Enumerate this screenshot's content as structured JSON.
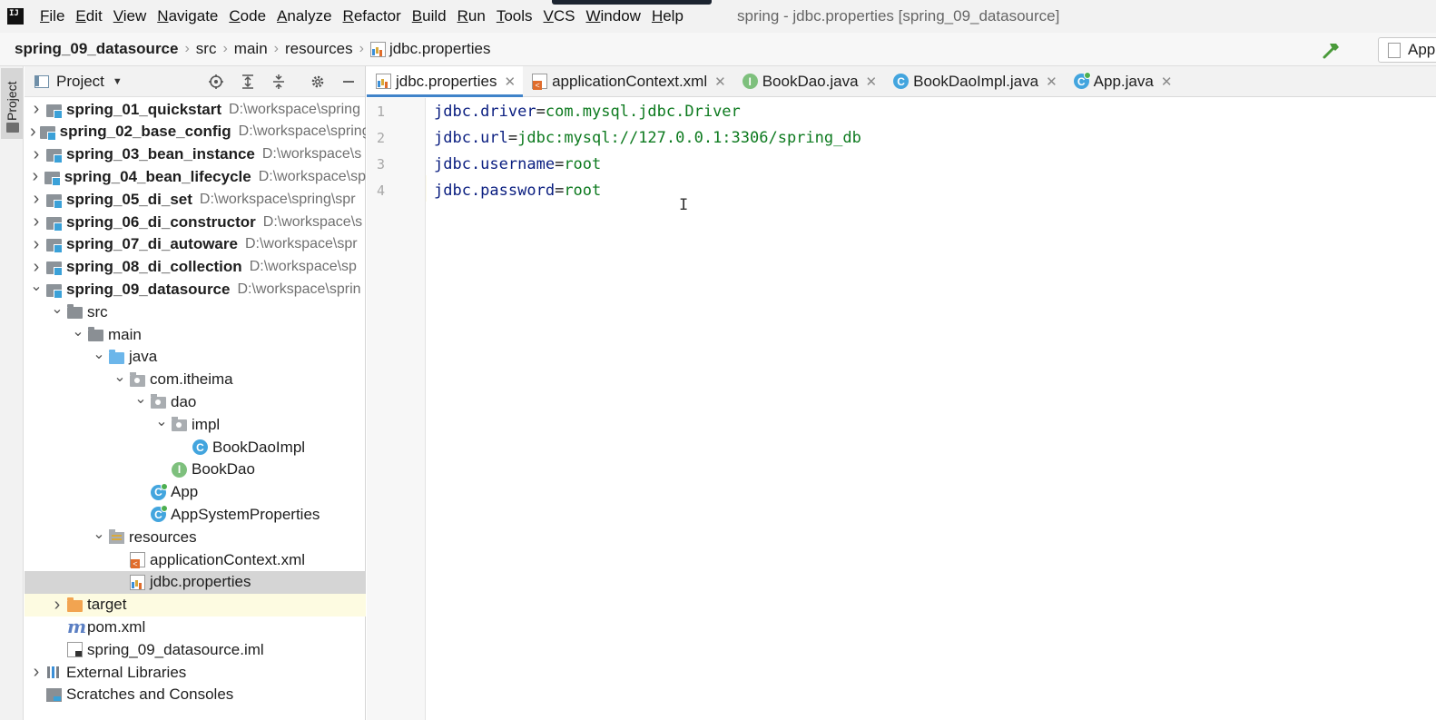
{
  "menu": {
    "logo": "IJ",
    "items": [
      "File",
      "Edit",
      "View",
      "Navigate",
      "Code",
      "Analyze",
      "Refactor",
      "Build",
      "Run",
      "Tools",
      "VCS",
      "Window",
      "Help"
    ],
    "window_title": "spring - jdbc.properties [spring_09_datasource]"
  },
  "breadcrumb": [
    "spring_09_datasource",
    "src",
    "main",
    "resources",
    "jdbc.properties"
  ],
  "run_config": {
    "label": "App"
  },
  "tool_stripe": {
    "project_label": "Project"
  },
  "project_panel": {
    "title": "Project",
    "tree": [
      {
        "depth": 0,
        "expand": "collapsed",
        "icon": "module",
        "label": "spring_01_quickstart",
        "bold": true,
        "path": "D:\\workspace\\spring"
      },
      {
        "depth": 0,
        "expand": "collapsed",
        "icon": "module",
        "label": "spring_02_base_config",
        "bold": true,
        "path": "D:\\workspace\\spring"
      },
      {
        "depth": 0,
        "expand": "collapsed",
        "icon": "module",
        "label": "spring_03_bean_instance",
        "bold": true,
        "path": "D:\\workspace\\s"
      },
      {
        "depth": 0,
        "expand": "collapsed",
        "icon": "module",
        "label": "spring_04_bean_lifecycle",
        "bold": true,
        "path": "D:\\workspace\\sp"
      },
      {
        "depth": 0,
        "expand": "collapsed",
        "icon": "module",
        "label": "spring_05_di_set",
        "bold": true,
        "path": "D:\\workspace\\spring\\spr"
      },
      {
        "depth": 0,
        "expand": "collapsed",
        "icon": "module",
        "label": "spring_06_di_constructor",
        "bold": true,
        "path": "D:\\workspace\\s"
      },
      {
        "depth": 0,
        "expand": "collapsed",
        "icon": "module",
        "label": "spring_07_di_autoware",
        "bold": true,
        "path": "D:\\workspace\\spr"
      },
      {
        "depth": 0,
        "expand": "collapsed",
        "icon": "module",
        "label": "spring_08_di_collection",
        "bold": true,
        "path": "D:\\workspace\\sp"
      },
      {
        "depth": 0,
        "expand": "expanded",
        "icon": "module",
        "label": "spring_09_datasource",
        "bold": true,
        "path": "D:\\workspace\\sprin"
      },
      {
        "depth": 1,
        "expand": "expanded",
        "icon": "folder",
        "label": "src",
        "bold": false,
        "path": ""
      },
      {
        "depth": 2,
        "expand": "expanded",
        "icon": "folder",
        "label": "main",
        "bold": false,
        "path": ""
      },
      {
        "depth": 3,
        "expand": "expanded",
        "icon": "folder-blue",
        "label": "java",
        "bold": false,
        "path": ""
      },
      {
        "depth": 4,
        "expand": "expanded",
        "icon": "package",
        "label": "com.itheima",
        "bold": false,
        "path": ""
      },
      {
        "depth": 5,
        "expand": "expanded",
        "icon": "package",
        "label": "dao",
        "bold": false,
        "path": ""
      },
      {
        "depth": 6,
        "expand": "expanded",
        "icon": "package",
        "label": "impl",
        "bold": false,
        "path": ""
      },
      {
        "depth": 7,
        "expand": "none",
        "icon": "class",
        "label": "BookDaoImpl",
        "bold": false,
        "path": ""
      },
      {
        "depth": 6,
        "expand": "none",
        "icon": "interface",
        "label": "BookDao",
        "bold": false,
        "path": ""
      },
      {
        "depth": 5,
        "expand": "none",
        "icon": "class-main",
        "label": "App",
        "bold": false,
        "path": ""
      },
      {
        "depth": 5,
        "expand": "none",
        "icon": "class-main",
        "label": "AppSystemProperties",
        "bold": false,
        "path": ""
      },
      {
        "depth": 3,
        "expand": "expanded",
        "icon": "resources",
        "label": "resources",
        "bold": false,
        "path": ""
      },
      {
        "depth": 4,
        "expand": "none",
        "icon": "xml",
        "label": "applicationContext.xml",
        "bold": false,
        "path": ""
      },
      {
        "depth": 4,
        "expand": "none",
        "icon": "properties",
        "label": "jdbc.properties",
        "bold": false,
        "path": "",
        "selected": true
      },
      {
        "depth": 1,
        "expand": "collapsed",
        "icon": "folder-orange",
        "label": "target",
        "bold": false,
        "path": "",
        "highlight": true
      },
      {
        "depth": 1,
        "expand": "none",
        "icon": "maven",
        "label": "pom.xml",
        "bold": false,
        "path": ""
      },
      {
        "depth": 1,
        "expand": "none",
        "icon": "iml",
        "label": "spring_09_datasource.iml",
        "bold": false,
        "path": ""
      },
      {
        "depth": 0,
        "expand": "collapsed",
        "icon": "libraries",
        "label": "External Libraries",
        "bold": false,
        "path": ""
      },
      {
        "depth": 0,
        "expand": "none",
        "icon": "scratch",
        "label": "Scratches and Consoles",
        "bold": false,
        "path": ""
      }
    ]
  },
  "editor": {
    "tabs": [
      {
        "label": "jdbc.properties",
        "icon": "properties",
        "active": true
      },
      {
        "label": "applicationContext.xml",
        "icon": "xml",
        "active": false
      },
      {
        "label": "BookDao.java",
        "icon": "interface",
        "active": false
      },
      {
        "label": "BookDaoImpl.java",
        "icon": "class",
        "active": false
      },
      {
        "label": "App.java",
        "icon": "class-main",
        "active": false
      }
    ],
    "lines": [
      {
        "no": "1",
        "key": "jdbc.driver",
        "value": "com.mysql.jdbc.Driver"
      },
      {
        "no": "2",
        "key": "jdbc.url",
        "value": "jdbc:mysql://127.0.0.1:3306/spring_db"
      },
      {
        "no": "3",
        "key": "jdbc.username",
        "value": "root"
      },
      {
        "no": "4",
        "key": "jdbc.password",
        "value": "root"
      }
    ]
  }
}
